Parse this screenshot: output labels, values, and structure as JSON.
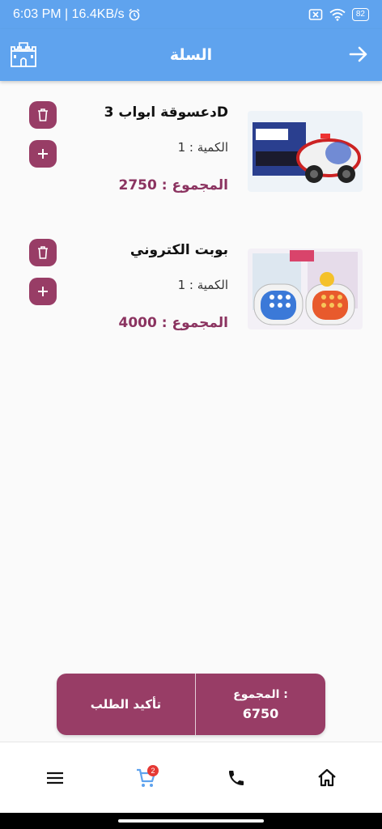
{
  "status": {
    "time_speed": "6:03 PM | 16.4KB/s",
    "battery": "82"
  },
  "appbar": {
    "title": "السلة"
  },
  "cart": {
    "items": [
      {
        "name": "دعسوقة ابواب 3D",
        "quantity": "الكمية : 1",
        "total": "المجموع : 2750"
      },
      {
        "name": "بوبت الكتروني",
        "quantity": "الكمية : 1",
        "total": "المجموع : 4000"
      }
    ]
  },
  "checkout": {
    "confirm_label": "تأكيد الطلب",
    "sum_label": "المجموع :",
    "sum_value": "6750"
  },
  "nav": {
    "cart_badge": "2",
    "icons": [
      "menu-icon",
      "cart-icon",
      "phone-icon",
      "home-icon"
    ]
  },
  "colors": {
    "primary": "#5fa3ee",
    "accent": "#983d66",
    "price": "#8b3360",
    "badge": "#e53935"
  }
}
